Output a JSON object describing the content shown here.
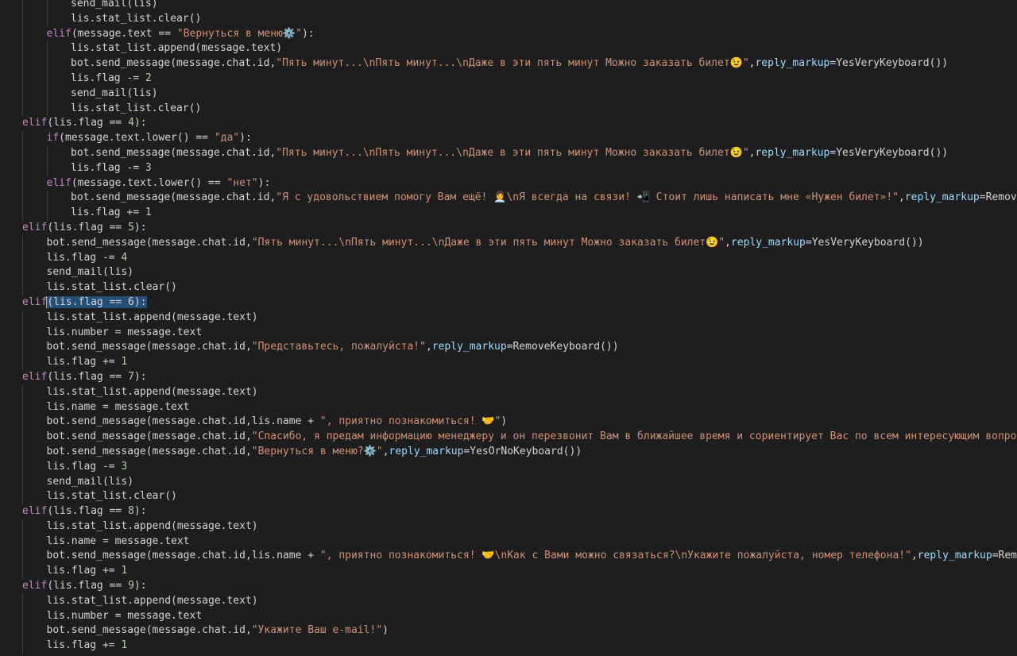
{
  "editor": {
    "language": "python",
    "theme_colors": {
      "background": "#1e1e1e",
      "keyword": "#c586c0",
      "string": "#ce9178",
      "param": "#9cdcfe",
      "number": "#b5cea8",
      "text": "#d4d4d4",
      "selection": "#264f78"
    },
    "lines": [
      {
        "indent": 3,
        "tokens": [
          {
            "t": "send_mail(lis)",
            "c": "plain"
          }
        ]
      },
      {
        "indent": 3,
        "tokens": [
          {
            "t": "lis.stat_list.clear()",
            "c": "plain"
          }
        ]
      },
      {
        "indent": 2,
        "tokens": [
          {
            "t": "elif",
            "c": "kw"
          },
          {
            "t": "(message.text == ",
            "c": "plain"
          },
          {
            "t": "\"Вернуться в меню⚙️\"",
            "c": "str"
          },
          {
            "t": "):",
            "c": "plain"
          }
        ]
      },
      {
        "indent": 3,
        "tokens": [
          {
            "t": "lis.stat_list.append(message.text)",
            "c": "plain"
          }
        ]
      },
      {
        "indent": 3,
        "tokens": [
          {
            "t": "bot.send_message(message.chat.id,",
            "c": "plain"
          },
          {
            "t": "\"Пять минут...\\nПять минут...\\nДаже в эти пять минут Можно заказать билет😉\"",
            "c": "str"
          },
          {
            "t": ",",
            "c": "plain"
          },
          {
            "t": "reply_markup",
            "c": "par"
          },
          {
            "t": "=YesVeryKeyboard())",
            "c": "plain"
          }
        ]
      },
      {
        "indent": 3,
        "tokens": [
          {
            "t": "lis.flag -= ",
            "c": "plain"
          },
          {
            "t": "2",
            "c": "num"
          }
        ]
      },
      {
        "indent": 3,
        "tokens": [
          {
            "t": "send_mail(lis)",
            "c": "plain"
          }
        ]
      },
      {
        "indent": 3,
        "tokens": [
          {
            "t": "lis.stat_list.clear()",
            "c": "plain"
          }
        ]
      },
      {
        "indent": 1,
        "tokens": [
          {
            "t": "elif",
            "c": "kw"
          },
          {
            "t": "(lis.flag == ",
            "c": "plain"
          },
          {
            "t": "4",
            "c": "num"
          },
          {
            "t": "):",
            "c": "plain"
          }
        ]
      },
      {
        "indent": 2,
        "tokens": [
          {
            "t": "if",
            "c": "kw"
          },
          {
            "t": "(message.text.lower() == ",
            "c": "plain"
          },
          {
            "t": "\"да\"",
            "c": "str"
          },
          {
            "t": "):",
            "c": "plain"
          }
        ]
      },
      {
        "indent": 3,
        "tokens": [
          {
            "t": "bot.send_message(message.chat.id,",
            "c": "plain"
          },
          {
            "t": "\"Пять минут...\\nПять минут...\\nДаже в эти пять минут Можно заказать билет😉\"",
            "c": "str"
          },
          {
            "t": ",",
            "c": "plain"
          },
          {
            "t": "reply_markup",
            "c": "par"
          },
          {
            "t": "=YesVeryKeyboard())",
            "c": "plain"
          }
        ]
      },
      {
        "indent": 3,
        "tokens": [
          {
            "t": "lis.flag -= ",
            "c": "plain"
          },
          {
            "t": "3",
            "c": "num"
          }
        ]
      },
      {
        "indent": 2,
        "tokens": [
          {
            "t": "elif",
            "c": "kw"
          },
          {
            "t": "(message.text.lower() == ",
            "c": "plain"
          },
          {
            "t": "\"нет\"",
            "c": "str"
          },
          {
            "t": "):",
            "c": "plain"
          }
        ]
      },
      {
        "indent": 3,
        "tokens": [
          {
            "t": "bot.send_message(message.chat.id,",
            "c": "plain"
          },
          {
            "t": "\"Я с удовольствием помогу Вам ещё! 👩‍💼\\nЯ всегда на связи! 📲 Стоит лишь написать мне «Нужен билет»!\"",
            "c": "str"
          },
          {
            "t": ",",
            "c": "plain"
          },
          {
            "t": "reply_markup",
            "c": "par"
          },
          {
            "t": "=RemoveKeyboard())",
            "c": "plain"
          }
        ]
      },
      {
        "indent": 3,
        "tokens": [
          {
            "t": "lis.flag += ",
            "c": "plain"
          },
          {
            "t": "1",
            "c": "num"
          }
        ]
      },
      {
        "indent": 1,
        "tokens": [
          {
            "t": "elif",
            "c": "kw"
          },
          {
            "t": "(lis.flag == ",
            "c": "plain"
          },
          {
            "t": "5",
            "c": "num"
          },
          {
            "t": "):",
            "c": "plain"
          }
        ]
      },
      {
        "indent": 2,
        "tokens": [
          {
            "t": "bot.send_message(message.chat.id,",
            "c": "plain"
          },
          {
            "t": "\"Пять минут...\\nПять минут...\\nДаже в эти пять минут Можно заказать билет😉\"",
            "c": "str"
          },
          {
            "t": ",",
            "c": "plain"
          },
          {
            "t": "reply_markup",
            "c": "par"
          },
          {
            "t": "=YesVeryKeyboard())",
            "c": "plain"
          }
        ]
      },
      {
        "indent": 2,
        "tokens": [
          {
            "t": "lis.flag -= ",
            "c": "plain"
          },
          {
            "t": "4",
            "c": "num"
          }
        ]
      },
      {
        "indent": 2,
        "tokens": [
          {
            "t": "send_mail(lis)",
            "c": "plain"
          }
        ]
      },
      {
        "indent": 2,
        "tokens": [
          {
            "t": "lis.stat_list.clear()",
            "c": "plain"
          }
        ]
      },
      {
        "indent": 1,
        "tokens": [
          {
            "t": "elif",
            "c": "kw"
          },
          {
            "t": "(lis.flag == 6):",
            "c": "sel"
          }
        ]
      },
      {
        "indent": 2,
        "tokens": [
          {
            "t": "lis.stat_list.append(message.text)",
            "c": "plain"
          }
        ]
      },
      {
        "indent": 2,
        "tokens": [
          {
            "t": "lis.number = message.text",
            "c": "plain"
          }
        ]
      },
      {
        "indent": 2,
        "tokens": [
          {
            "t": "bot.send_message(message.chat.id,",
            "c": "plain"
          },
          {
            "t": "\"Представьтесь, пожалуйста!\"",
            "c": "str"
          },
          {
            "t": ",",
            "c": "plain"
          },
          {
            "t": "reply_markup",
            "c": "par"
          },
          {
            "t": "=RemoveKeyboard())",
            "c": "plain"
          }
        ]
      },
      {
        "indent": 2,
        "tokens": [
          {
            "t": "lis.flag += ",
            "c": "plain"
          },
          {
            "t": "1",
            "c": "num"
          }
        ]
      },
      {
        "indent": 1,
        "tokens": [
          {
            "t": "elif",
            "c": "kw"
          },
          {
            "t": "(lis.flag == ",
            "c": "plain"
          },
          {
            "t": "7",
            "c": "num"
          },
          {
            "t": "):",
            "c": "plain"
          }
        ]
      },
      {
        "indent": 2,
        "tokens": [
          {
            "t": "lis.stat_list.append(message.text)",
            "c": "plain"
          }
        ]
      },
      {
        "indent": 2,
        "tokens": [
          {
            "t": "lis.name = message.text",
            "c": "plain"
          }
        ]
      },
      {
        "indent": 2,
        "tokens": [
          {
            "t": "bot.send_message(message.chat.id,lis.name + ",
            "c": "plain"
          },
          {
            "t": "\", приятно познакомиться! 🤝\"",
            "c": "str"
          },
          {
            "t": ")",
            "c": "plain"
          }
        ]
      },
      {
        "indent": 2,
        "tokens": [
          {
            "t": "bot.send_message(message.chat.id,",
            "c": "plain"
          },
          {
            "t": "\"Спасибо, я предам информацию менеджеру и он перезвонит Вам в ближайшее время и сориентирует Вас по всем интересующим вопросам.",
            "c": "str"
          }
        ]
      },
      {
        "indent": 2,
        "tokens": [
          {
            "t": "bot.send_message(message.chat.id,",
            "c": "plain"
          },
          {
            "t": "\"Вернуться в меню?⚙️\"",
            "c": "str"
          },
          {
            "t": ",",
            "c": "plain"
          },
          {
            "t": "reply_markup",
            "c": "par"
          },
          {
            "t": "=YesOrNoKeyboard())",
            "c": "plain"
          }
        ]
      },
      {
        "indent": 2,
        "tokens": [
          {
            "t": "lis.flag -= ",
            "c": "plain"
          },
          {
            "t": "3",
            "c": "num"
          }
        ]
      },
      {
        "indent": 2,
        "tokens": [
          {
            "t": "send_mail(lis)",
            "c": "plain"
          }
        ]
      },
      {
        "indent": 2,
        "tokens": [
          {
            "t": "lis.stat_list.clear()",
            "c": "plain"
          }
        ]
      },
      {
        "indent": 1,
        "tokens": [
          {
            "t": "elif",
            "c": "kw"
          },
          {
            "t": "(lis.flag == ",
            "c": "plain"
          },
          {
            "t": "8",
            "c": "num"
          },
          {
            "t": "):",
            "c": "plain"
          }
        ]
      },
      {
        "indent": 2,
        "tokens": [
          {
            "t": "lis.stat_list.append(message.text)",
            "c": "plain"
          }
        ]
      },
      {
        "indent": 2,
        "tokens": [
          {
            "t": "lis.name = message.text",
            "c": "plain"
          }
        ]
      },
      {
        "indent": 2,
        "tokens": [
          {
            "t": "bot.send_message(message.chat.id,lis.name + ",
            "c": "plain"
          },
          {
            "t": "\", приятно познакомиться! 🤝\\nКак с Вами можно связаться?\\nУкажите пожалуйста, номер телефона!\"",
            "c": "str"
          },
          {
            "t": ",",
            "c": "plain"
          },
          {
            "t": "reply_markup",
            "c": "par"
          },
          {
            "t": "=RemoveKeyboard())",
            "c": "plain"
          }
        ]
      },
      {
        "indent": 2,
        "tokens": [
          {
            "t": "lis.flag += ",
            "c": "plain"
          },
          {
            "t": "1",
            "c": "num"
          }
        ]
      },
      {
        "indent": 1,
        "tokens": [
          {
            "t": "elif",
            "c": "kw"
          },
          {
            "t": "(lis.flag == ",
            "c": "plain"
          },
          {
            "t": "9",
            "c": "num"
          },
          {
            "t": "):",
            "c": "plain"
          }
        ]
      },
      {
        "indent": 2,
        "tokens": [
          {
            "t": "lis.stat_list.append(message.text)",
            "c": "plain"
          }
        ]
      },
      {
        "indent": 2,
        "tokens": [
          {
            "t": "lis.number = message.text",
            "c": "plain"
          }
        ]
      },
      {
        "indent": 2,
        "tokens": [
          {
            "t": "bot.send_message(message.chat.id,",
            "c": "plain"
          },
          {
            "t": "\"Укажите Ваш e-mail!\"",
            "c": "str"
          },
          {
            "t": ")",
            "c": "plain"
          }
        ]
      },
      {
        "indent": 2,
        "tokens": [
          {
            "t": "lis.flag += ",
            "c": "plain"
          },
          {
            "t": "1",
            "c": "num"
          }
        ]
      }
    ]
  }
}
